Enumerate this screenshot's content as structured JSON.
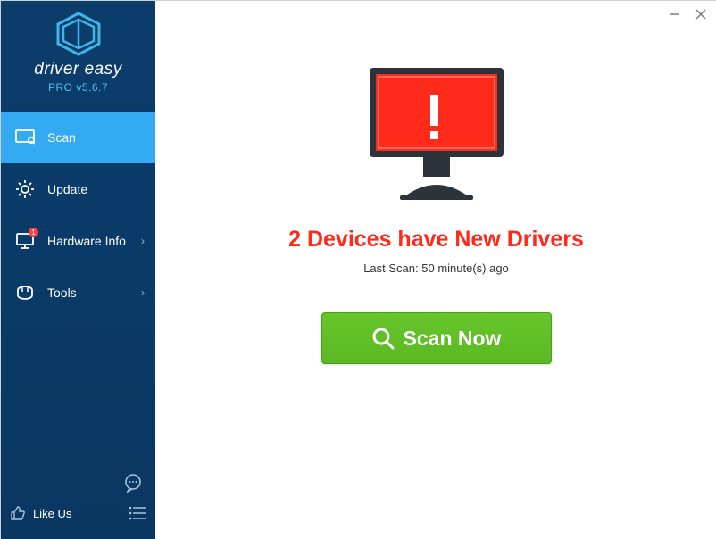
{
  "branding": {
    "product_name": "driver easy",
    "version_label": "PRO v5.6.7"
  },
  "sidebar": {
    "scan_label": "Scan",
    "update_label": "Update",
    "hardware_label": "Hardware Info",
    "hardware_badge": "1",
    "tools_label": "Tools",
    "likeus_label": "Like Us"
  },
  "main": {
    "headline": "2 Devices have New Drivers",
    "last_scan": "Last Scan: 50 minute(s) ago",
    "scan_button": "Scan Now"
  },
  "icons": {
    "scan": "scan-icon",
    "update": "gear-icon",
    "hardware": "monitor-icon",
    "tools": "toolbox-icon",
    "feedback": "chat-icon",
    "likeus": "thumbs-up-icon",
    "menu": "menu-icon",
    "minimize": "minimize-icon",
    "close": "close-icon",
    "search": "search-icon",
    "chevron": "chevron-right-icon"
  }
}
